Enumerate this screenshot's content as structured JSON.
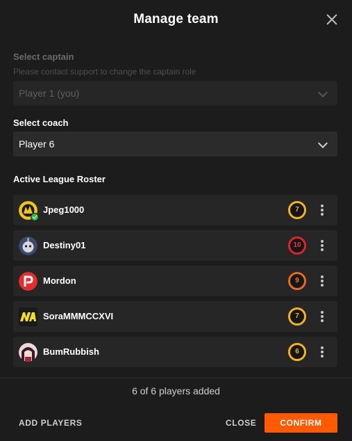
{
  "header": {
    "title": "Manage team"
  },
  "captain": {
    "label": "Select captain",
    "hint": "Please contact support to change the captain role",
    "value": "Player 1 (you)"
  },
  "coach": {
    "label": "Select coach",
    "value": "Player 6"
  },
  "roster": {
    "label": "Active League Roster",
    "players": [
      {
        "name": "Jpeg1000",
        "rank": "7",
        "rank_color": "#f2b41e",
        "is_captain": true
      },
      {
        "name": "Destiny01",
        "rank": "10",
        "rank_color": "#d9262b"
      },
      {
        "name": "Mordon",
        "rank": "9",
        "rank_color": "#ea6a1e"
      },
      {
        "name": "SoraMMMCCXVI",
        "rank": "7",
        "rank_color": "#f2b41e"
      },
      {
        "name": "BumRubbish",
        "rank": "6",
        "rank_color": "#f2b41e"
      }
    ]
  },
  "count_text": "6 of 6 players added",
  "footer": {
    "add_players": "ADD PLAYERS",
    "close": "CLOSE",
    "confirm": "CONFIRM"
  },
  "colors": {
    "accent": "#ff5a00",
    "background": "#1c1c1c",
    "row": "#262626"
  }
}
